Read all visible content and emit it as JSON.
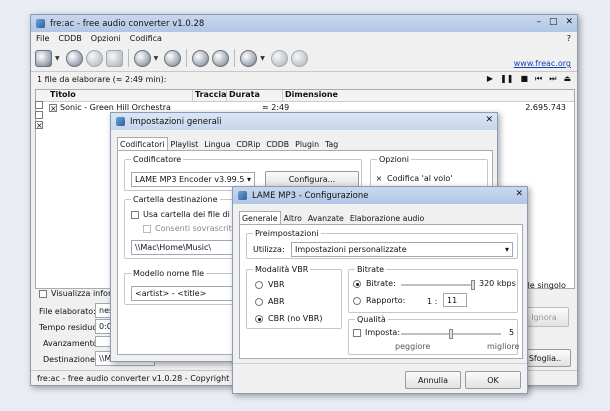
{
  "main": {
    "title": "fre:ac - free audio converter v1.0.28",
    "controls": {
      "minimize": "–",
      "maximize": "□",
      "close": "✕"
    },
    "menu": [
      "File",
      "CDDB",
      "Opzioni",
      "Codifica"
    ],
    "help": "?",
    "link": "www.freac.org",
    "files_count": "1 file da elaborare (≈ 2:49 min):",
    "columns": {
      "title": "Titolo",
      "track": "Traccia",
      "duration": "Durata",
      "size": "Dimensione"
    },
    "rows": [
      {
        "title": "Sonic - Green Hill Orchestra",
        "duration": "≈ 2:49",
        "size": "2.695.743"
      }
    ],
    "visualizza": "Visualizza informa",
    "file_singolo": "n file singolo",
    "file_elaborato_label": "File elaborato:",
    "file_elaborato_value": "nes",
    "tempo_residuo_label": "Tempo residuo:",
    "tempo_residuo_value": "0:0",
    "avanzamento_label": "Avanzamento:",
    "destinazione_label": "Destinazione:",
    "destinazione_value": "\\\\Mac\\Home\\Music\\",
    "ignora": "Ignora",
    "sfoglia": "Sfoglia..",
    "status": "fre:ac - free audio converter v1.0.28 - Copyright (C) 2001-20"
  },
  "settings": {
    "title": "Impostazioni generali",
    "close": "✕",
    "tabs": [
      "Codificatori",
      "Playlist",
      "Lingua",
      "CDRip",
      "CDDB",
      "Plugin",
      "Tag"
    ],
    "codificatore_label": "Codificatore",
    "encoder": "LAME MP3 Encoder v3.99.5",
    "configura": "Configura...",
    "opzioni_label": "Opzioni",
    "codifica_al_volo": "Codifica 'al volo'",
    "cartella_label": "Cartella destinazione",
    "usa_cartella": "Usa cartella dei file di origin",
    "consenti": "Consenti sovrascrittura f",
    "dest_path": "\\\\Mac\\Home\\Music\\",
    "modello_label": "Modello nome file",
    "pattern": "<artist> - <title>"
  },
  "lame": {
    "title": "LAME MP3 - Configurazione",
    "close": "✕",
    "tabs": [
      "Generale",
      "Altro",
      "Avanzate",
      "Elaborazione audio"
    ],
    "preimpostazioni_label": "Preimpostazioni",
    "utilizza_label": "Utilizza:",
    "utilizza_value": "Impostazioni personalizzate",
    "modalita_label": "Modalità VBR",
    "vbr_options": [
      "VBR",
      "ABR",
      "CBR (no VBR)"
    ],
    "bitrate_group": "Bitrate",
    "bitrate_label": "Bitrate:",
    "bitrate_value": "320 kbps",
    "rapporto_label": "Rapporto:",
    "rapporto_prefix": "1 :",
    "rapporto_value": "11",
    "qualita_label": "Qualità",
    "imposta_label": "Imposta:",
    "quality_value": "5",
    "peggiore": "peggiore",
    "migliore": "migliore",
    "annulla": "Annulla",
    "ok": "OK"
  }
}
